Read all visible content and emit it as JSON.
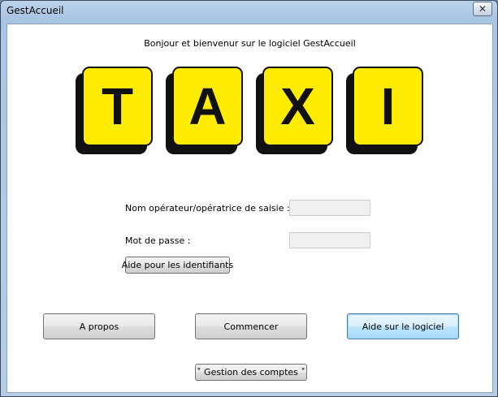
{
  "window": {
    "title": "GestAccueil",
    "close_glyph": "✕"
  },
  "welcome_text": "Bonjour et bienvenur sur le logiciel GestAccueil",
  "logo": {
    "letters": [
      "T",
      "A",
      "X",
      "I"
    ],
    "tile_color": "#ffec00",
    "ink_color": "#111111"
  },
  "form": {
    "operator_label": "Nom opérateur/opératrice de saisie :",
    "operator_value": "",
    "password_label": "Mot de passe :",
    "password_value": "",
    "help_ids_button": "Aide pour les identifiants"
  },
  "buttons": {
    "about": "A propos",
    "start": "Commencer",
    "help_software": "Aide sur le logiciel",
    "accounts": "˚ Gestion des comptes ˚"
  }
}
